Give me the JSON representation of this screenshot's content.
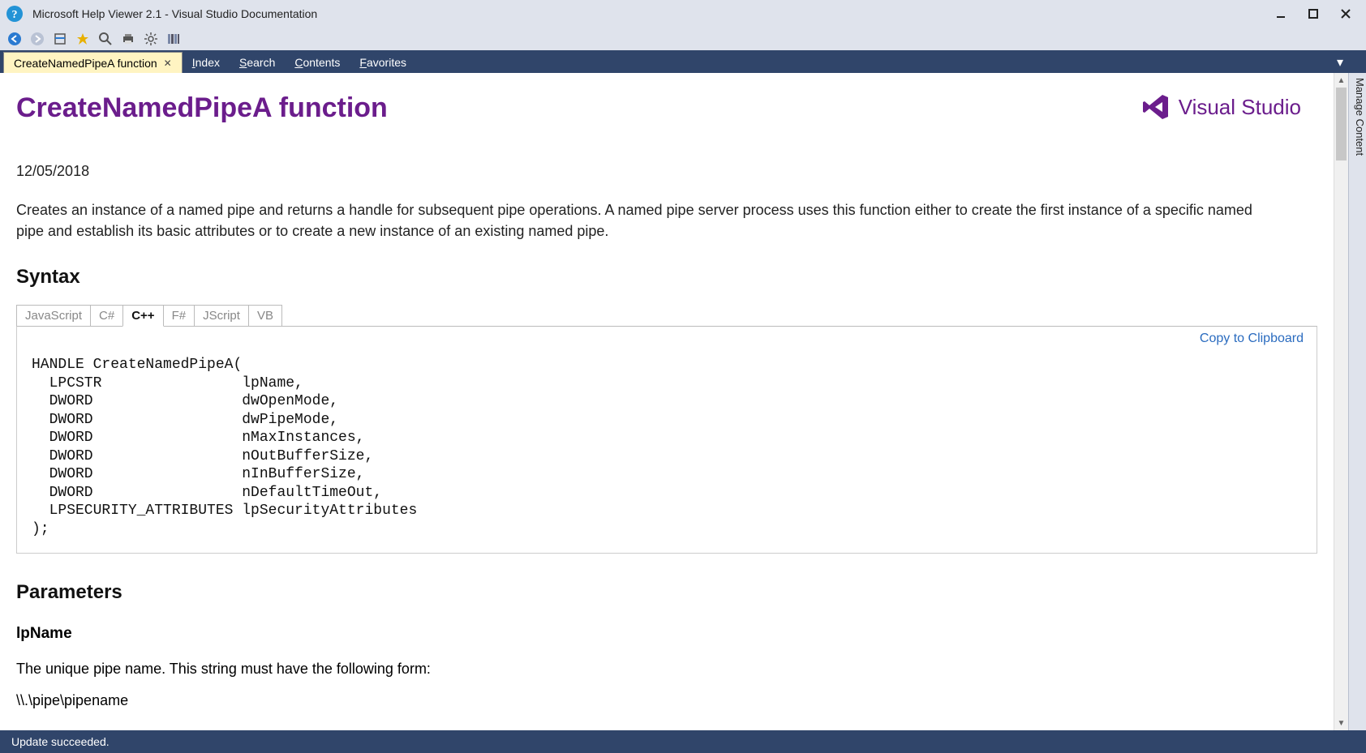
{
  "window": {
    "title": "Microsoft Help Viewer 2.1 - Visual Studio Documentation"
  },
  "nav": {
    "active_tab": "CreateNamedPipeA function",
    "tabs": [
      "Index",
      "Search",
      "Contents",
      "Favorites"
    ]
  },
  "sidetab": {
    "label": "Manage Content"
  },
  "status": {
    "text": "Update succeeded."
  },
  "page": {
    "title": "CreateNamedPipeA function",
    "logo_text": "Visual Studio",
    "date": "12/05/2018",
    "description": "Creates an instance of a named pipe and returns a handle for subsequent pipe operations. A named pipe server process uses this function either to create the first instance of a specific named pipe and establish its basic attributes or to create a new instance of an existing named pipe.",
    "syntax_heading": "Syntax",
    "lang_tabs": [
      "JavaScript",
      "C#",
      "C++",
      "F#",
      "JScript",
      "VB"
    ],
    "active_lang": "C++",
    "copy_label": "Copy to Clipboard",
    "code": "HANDLE CreateNamedPipeA(\n  LPCSTR                lpName,\n  DWORD                 dwOpenMode,\n  DWORD                 dwPipeMode,\n  DWORD                 nMaxInstances,\n  DWORD                 nOutBufferSize,\n  DWORD                 nInBufferSize,\n  DWORD                 nDefaultTimeOut,\n  LPSECURITY_ATTRIBUTES lpSecurityAttributes\n);",
    "params_heading": "Parameters",
    "param1_name": "lpName",
    "param1_desc": "The unique pipe name. This string must have the following form:",
    "param1_form": "\\\\.\\pipe\\pipename"
  }
}
